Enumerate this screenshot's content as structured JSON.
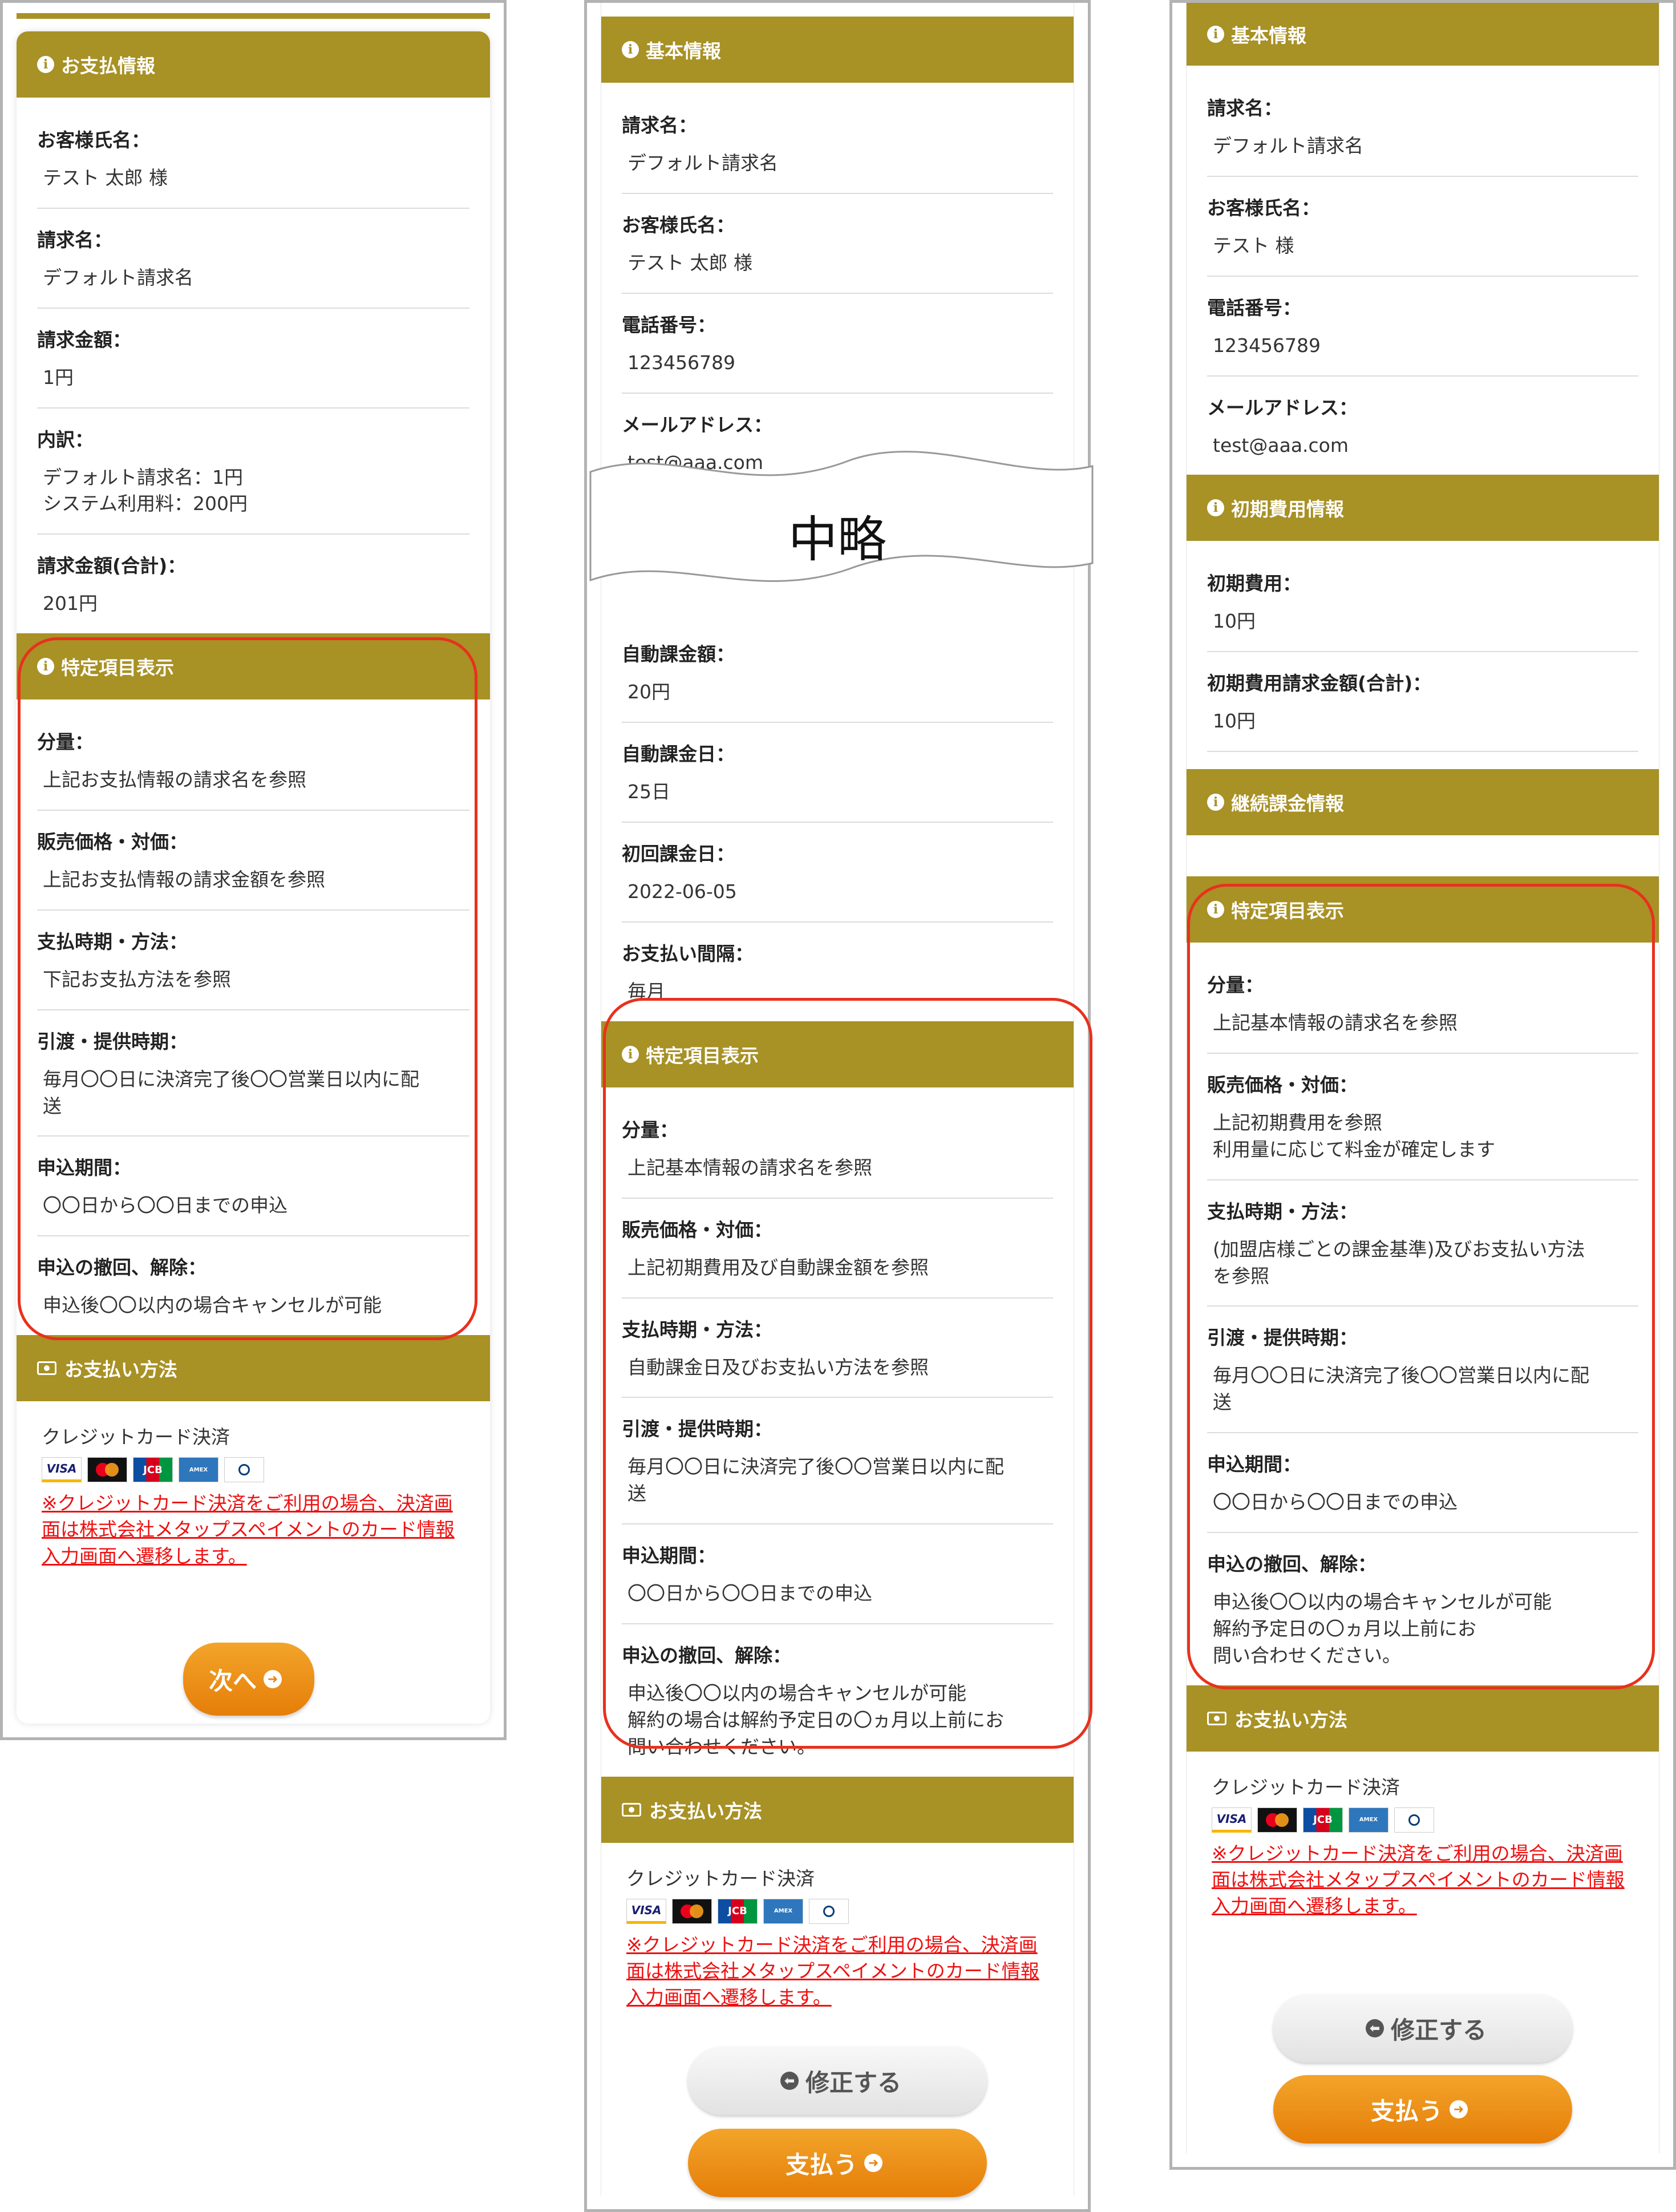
{
  "panel1": {
    "sections": [
      {
        "title": "お支払情報",
        "items": [
          {
            "label": "お客様氏名：",
            "value": "テスト 太郎 様"
          },
          {
            "label": "請求名：",
            "value": "デフォルト請求名"
          },
          {
            "label": "請求金額：",
            "value": "1円"
          },
          {
            "label": "内訳：",
            "value": "デフォルト請求名：1円\nシステム利用料：200円"
          },
          {
            "label": "請求金額(合計)：",
            "value": "201円"
          }
        ]
      },
      {
        "title": "特定項目表示",
        "items": [
          {
            "label": "分量：",
            "value": "上記お支払情報の請求名を参照"
          },
          {
            "label": "販売価格・対価：",
            "value": "上記お支払情報の請求金額を参照"
          },
          {
            "label": "支払時期・方法：",
            "value": "下記お支払方法を参照"
          },
          {
            "label": "引渡・提供時期：",
            "value": "毎月〇〇日に決済完了後〇〇営業日以内に配\n送"
          },
          {
            "label": "申込期間：",
            "value": "〇〇日から〇〇日までの申込"
          },
          {
            "label": "申込の撤回、解除：",
            "value": "申込後〇〇以内の場合キャンセルが可能"
          }
        ]
      }
    ],
    "payment": {
      "title": "お支払い方法",
      "method": "クレジットカード決済",
      "note": "※クレジットカード決済をご利用の場合、決済画面は株式会社メタップスペイメントのカード情報入力画面へ遷移します。"
    },
    "next_button": "次へ"
  },
  "panel2": {
    "sections": [
      {
        "title": "基本情報",
        "items": [
          {
            "label": "請求名：",
            "value": "デフォルト請求名"
          },
          {
            "label": "お客様氏名：",
            "value": "テスト 太郎 様"
          },
          {
            "label": "電話番号：",
            "value": "123456789"
          },
          {
            "label": "メールアドレス：",
            "value": "test@aaa.com"
          }
        ]
      },
      {
        "items": [
          {
            "label": "自動課金額：",
            "value": "20円"
          },
          {
            "label": "自動課金日：",
            "value": "25日"
          },
          {
            "label": "初回課金日：",
            "value": "2022-06-05"
          },
          {
            "label": "お支払い間隔：",
            "value": "毎月"
          }
        ]
      },
      {
        "title": "特定項目表示",
        "items": [
          {
            "label": "分量：",
            "value": "上記基本情報の請求名を参照"
          },
          {
            "label": "販売価格・対価：",
            "value": "上記初期費用及び自動課金額を参照"
          },
          {
            "label": "支払時期・方法：",
            "value": "自動課金日及びお支払い方法を参照"
          },
          {
            "label": "引渡・提供時期：",
            "value": "毎月〇〇日に決済完了後〇〇営業日以内に配\n送"
          },
          {
            "label": "申込期間：",
            "value": "〇〇日から〇〇日までの申込"
          },
          {
            "label": "申込の撤回、解除：",
            "value": "申込後〇〇以内の場合キャンセルが可能\n解約の場合は解約予定日の〇ヵ月以上前にお\n問い合わせください。"
          }
        ]
      }
    ],
    "omit_label": "中略",
    "payment": {
      "title": "お支払い方法",
      "method": "クレジットカード決済",
      "note": "※クレジットカード決済をご利用の場合、決済画面は株式会社メタップスペイメントのカード情報入力画面へ遷移します。"
    },
    "edit_button": "修正する",
    "pay_button": "支払う"
  },
  "panel3": {
    "sections": [
      {
        "title": "基本情報",
        "items": [
          {
            "label": "請求名：",
            "value": "デフォルト請求名"
          },
          {
            "label": "お客様氏名：",
            "value": "テスト 様"
          },
          {
            "label": "電話番号：",
            "value": "123456789"
          },
          {
            "label": "メールアドレス：",
            "value": "test@aaa.com"
          }
        ]
      },
      {
        "title": "初期費用情報",
        "items": [
          {
            "label": "初期費用：",
            "value": "10円"
          },
          {
            "label": "初期費用請求金額(合計)：",
            "value": "10円"
          }
        ]
      },
      {
        "title": "継続課金情報",
        "items": []
      },
      {
        "title": "特定項目表示",
        "items": [
          {
            "label": "分量：",
            "value": "上記基本情報の請求名を参照"
          },
          {
            "label": "販売価格・対価：",
            "value": "上記初期費用を参照\n利用量に応じて料金が確定します"
          },
          {
            "label": "支払時期・方法：",
            "value": "(加盟店様ごとの課金基準)及びお支払い方法\nを参照"
          },
          {
            "label": "引渡・提供時期：",
            "value": "毎月〇〇日に決済完了後〇〇営業日以内に配\n送"
          },
          {
            "label": "申込期間：",
            "value": "〇〇日から〇〇日までの申込"
          },
          {
            "label": "申込の撤回、解除：",
            "value": "申込後〇〇以内の場合キャンセルが可能\n解約予定日の〇ヵ月以上前にお\n問い合わせください。"
          }
        ]
      }
    ],
    "payment": {
      "title": "お支払い方法",
      "method": "クレジットカード決済",
      "note": "※クレジットカード決済をご利用の場合、決済画面は株式会社メタップスペイメントのカード情報入力画面へ遷移します。"
    },
    "edit_button": "修正する",
    "pay_button": "支払う"
  },
  "card_brands": [
    "VISA",
    "Mastercard",
    "JCB",
    "AMERICAN EXPRESS",
    "Diners Club"
  ],
  "colors": {
    "header_gold": "#a89125",
    "button_orange": "#e8860f",
    "highlight_red": "#e8311e",
    "note_red": "#ee1111"
  }
}
